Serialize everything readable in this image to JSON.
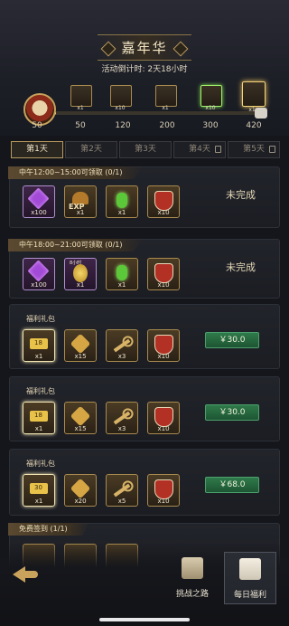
{
  "header": {
    "title": "嘉年华",
    "countdown": "活动倒计时: 2天18小时"
  },
  "milestones": {
    "progress": 0.12,
    "points": [
      "50",
      "50",
      "120",
      "200",
      "300",
      "420"
    ],
    "rewards": [
      {
        "icon": "helmet-chest-icon",
        "qty": "x1"
      },
      {
        "icon": "key-icon",
        "qty": "x10"
      },
      {
        "icon": "mystery-box-icon",
        "qty": "x1"
      },
      {
        "icon": "jade-key-icon",
        "qty": "x10"
      },
      {
        "icon": "gold-chest-icon",
        "qty": "x1"
      }
    ]
  },
  "tabs": [
    {
      "label": "第1天",
      "active": true,
      "locked": false
    },
    {
      "label": "第2天",
      "active": false,
      "locked": false
    },
    {
      "label": "第3天",
      "active": false,
      "locked": false
    },
    {
      "label": "第4天",
      "active": false,
      "locked": true
    },
    {
      "label": "第5天",
      "active": false,
      "locked": true
    }
  ],
  "cards": [
    {
      "title": "中午12:00~15:00可领取 (0/1)",
      "status": "未完成",
      "items": [
        {
          "icon": "gem-icon",
          "qty": "x100"
        },
        {
          "icon": "exp-helmet-icon",
          "qty": "x1",
          "text": "EXP"
        },
        {
          "icon": "potion-icon",
          "qty": "x1"
        },
        {
          "icon": "shield-icon",
          "qty": "x10"
        }
      ]
    },
    {
      "title": "中午18:00~21:00可领取 (0/1)",
      "status": "未完成",
      "items": [
        {
          "icon": "gem-icon",
          "qty": "x100"
        },
        {
          "icon": "coin-icon",
          "qty": "x1",
          "text": "8小时"
        },
        {
          "icon": "potion-icon",
          "qty": "x1"
        },
        {
          "icon": "shield-icon",
          "qty": "x10"
        }
      ]
    },
    {
      "title": "福利礼包",
      "price": "￥30.0",
      "items": [
        {
          "icon": "gold-bar-icon",
          "qty": "x1",
          "text": "18"
        },
        {
          "icon": "fire-crystal-icon",
          "qty": "x15"
        },
        {
          "icon": "key-icon",
          "qty": "x3"
        },
        {
          "icon": "shield-icon",
          "qty": "x10"
        }
      ]
    },
    {
      "title": "福利礼包",
      "price": "￥30.0",
      "items": [
        {
          "icon": "gold-bar-icon",
          "qty": "x1",
          "text": "18"
        },
        {
          "icon": "fire-crystal-icon",
          "qty": "x15"
        },
        {
          "icon": "key-icon",
          "qty": "x3"
        },
        {
          "icon": "shield-icon",
          "qty": "x10"
        }
      ]
    },
    {
      "title": "福利礼包",
      "price": "￥68.0",
      "items": [
        {
          "icon": "gold-bar-icon",
          "qty": "x1",
          "text": "30"
        },
        {
          "icon": "fire-crystal-icon",
          "qty": "x20"
        },
        {
          "icon": "key-icon",
          "qty": "x5"
        },
        {
          "icon": "shield-icon",
          "qty": "x10"
        }
      ]
    },
    {
      "title": "免费签到 (1/1)"
    }
  ],
  "bottom_nav": {
    "challenge_label": "挑战之路",
    "daily_label": "每日福利"
  },
  "colors": {
    "accent_gold": "#c9a35c",
    "price_green": "#2f7a4a"
  }
}
